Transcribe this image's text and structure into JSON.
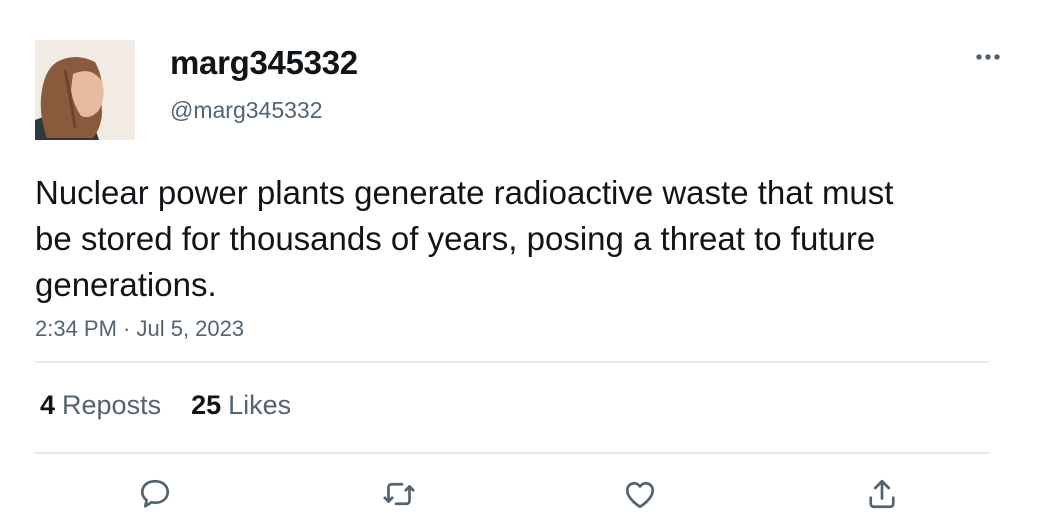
{
  "tweet": {
    "display_name": "marg345332",
    "handle": "@marg345332",
    "text": "Nuclear power plants generate radioactive waste that must be stored for thousands of years, posing a threat to future generations.",
    "timestamp": "2:34 PM · Jul 5, 2023"
  },
  "stats": {
    "reposts_count": "4",
    "reposts_label": "Reposts",
    "likes_count": "25",
    "likes_label": "Likes"
  },
  "actions": [
    "reply-icon",
    "repost-icon",
    "like-icon",
    "share-icon"
  ],
  "colors": {
    "text": "#0f1419",
    "secondary": "#536471",
    "divider": "#e6e8ea"
  }
}
